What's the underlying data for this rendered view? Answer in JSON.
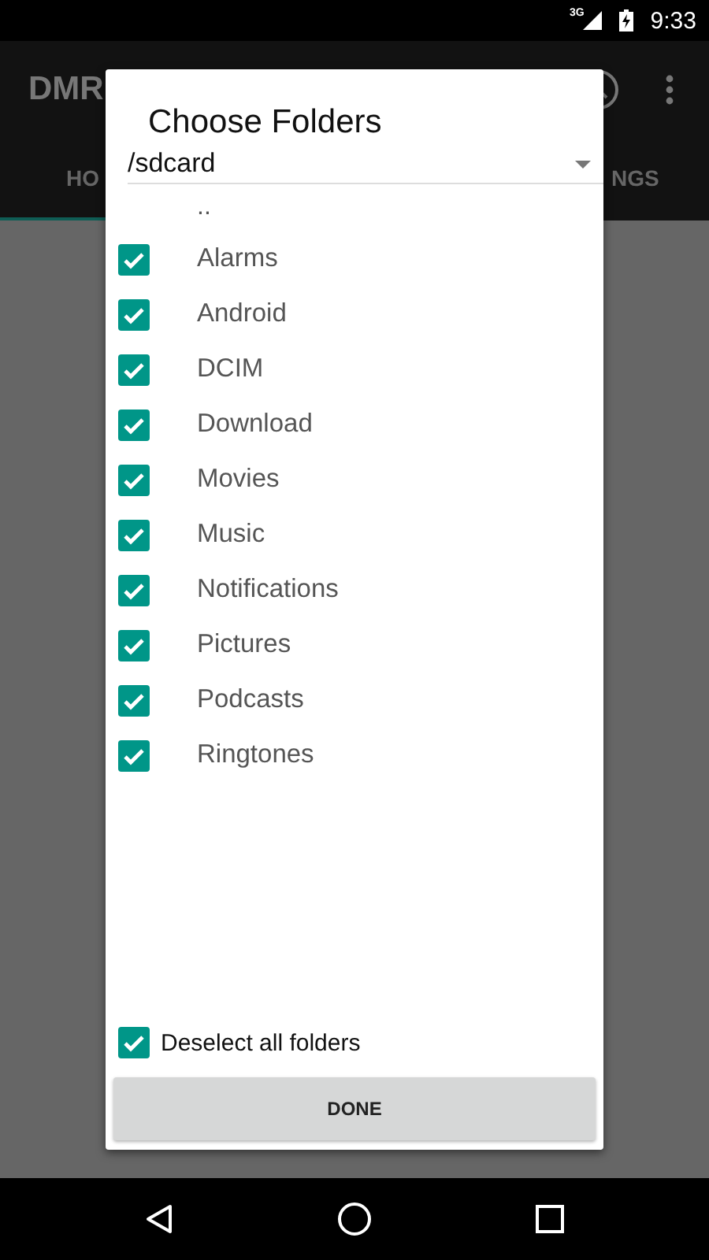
{
  "status_bar": {
    "network": "3G",
    "time": "9:33"
  },
  "app_bar": {
    "title": "DMR",
    "tabs": [
      {
        "label": "HO",
        "selected": true
      },
      {
        "label": "NGS",
        "selected": false
      }
    ]
  },
  "dialog": {
    "title": "Choose Folders",
    "path": "/sdcard",
    "items": [
      {
        "kind": "parent",
        "name": ".."
      },
      {
        "kind": "folder",
        "name": "Alarms",
        "checked": true
      },
      {
        "kind": "folder",
        "name": "Android",
        "checked": true
      },
      {
        "kind": "folder",
        "name": "DCIM",
        "checked": true
      },
      {
        "kind": "folder",
        "name": "Download",
        "checked": true
      },
      {
        "kind": "folder",
        "name": "Movies",
        "checked": true
      },
      {
        "kind": "folder",
        "name": "Music",
        "checked": true
      },
      {
        "kind": "folder",
        "name": "Notifications",
        "checked": true
      },
      {
        "kind": "folder",
        "name": "Pictures",
        "checked": true
      },
      {
        "kind": "folder",
        "name": "Podcasts",
        "checked": true
      },
      {
        "kind": "folder",
        "name": "Ringtones",
        "checked": true
      }
    ],
    "toggle_all": {
      "label": "Deselect all folders",
      "checked": true
    },
    "button": "DONE"
  }
}
